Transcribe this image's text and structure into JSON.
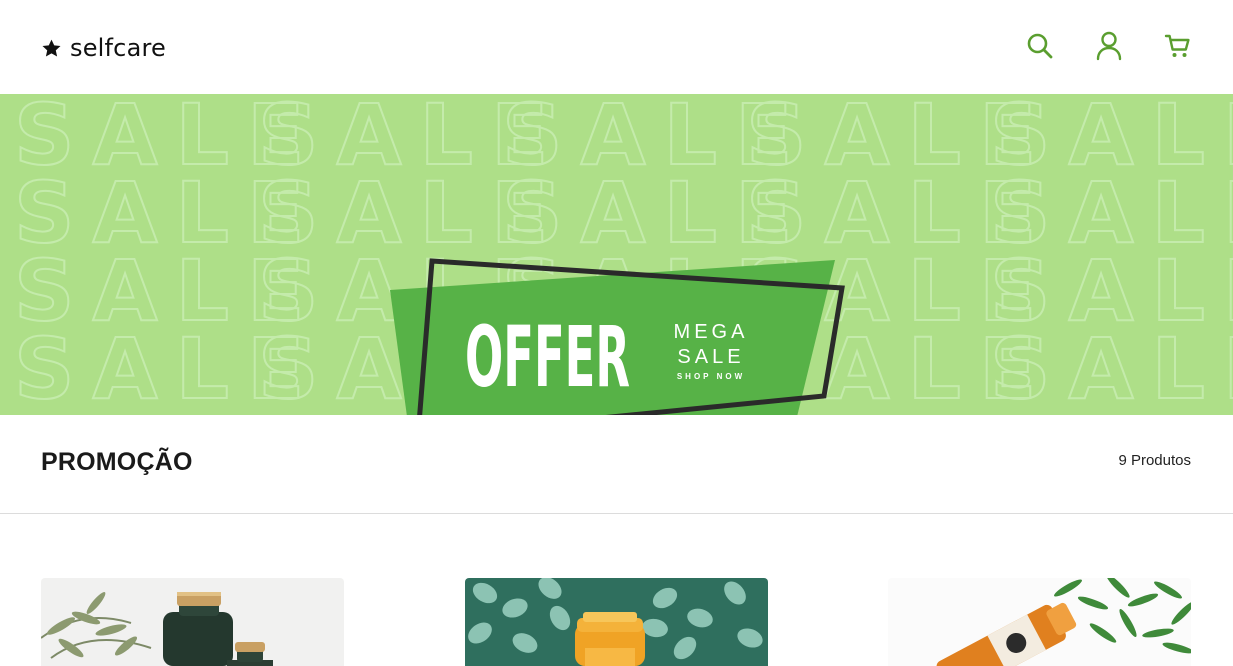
{
  "header": {
    "brand": "selfcare",
    "icons": [
      "star-icon",
      "search-icon",
      "user-icon",
      "cart-icon"
    ],
    "accent_color": "#5a9e2f"
  },
  "banner": {
    "background_word": "SALE",
    "offer_text": "OFFER",
    "mega_text": "MEGA",
    "sale_text": "SALE",
    "shop_now_text": "SHOP NOW",
    "background_color": "#aedf88",
    "badge_color": "#57b247"
  },
  "section": {
    "title": "PROMOÇÃO",
    "count": "9 Produtos"
  },
  "products": [
    {
      "image": "product-image-bottles-olive-branch"
    },
    {
      "image": "product-image-orange-juice-eucalyptus"
    },
    {
      "image": "product-image-juice-bottle-leaves"
    }
  ]
}
